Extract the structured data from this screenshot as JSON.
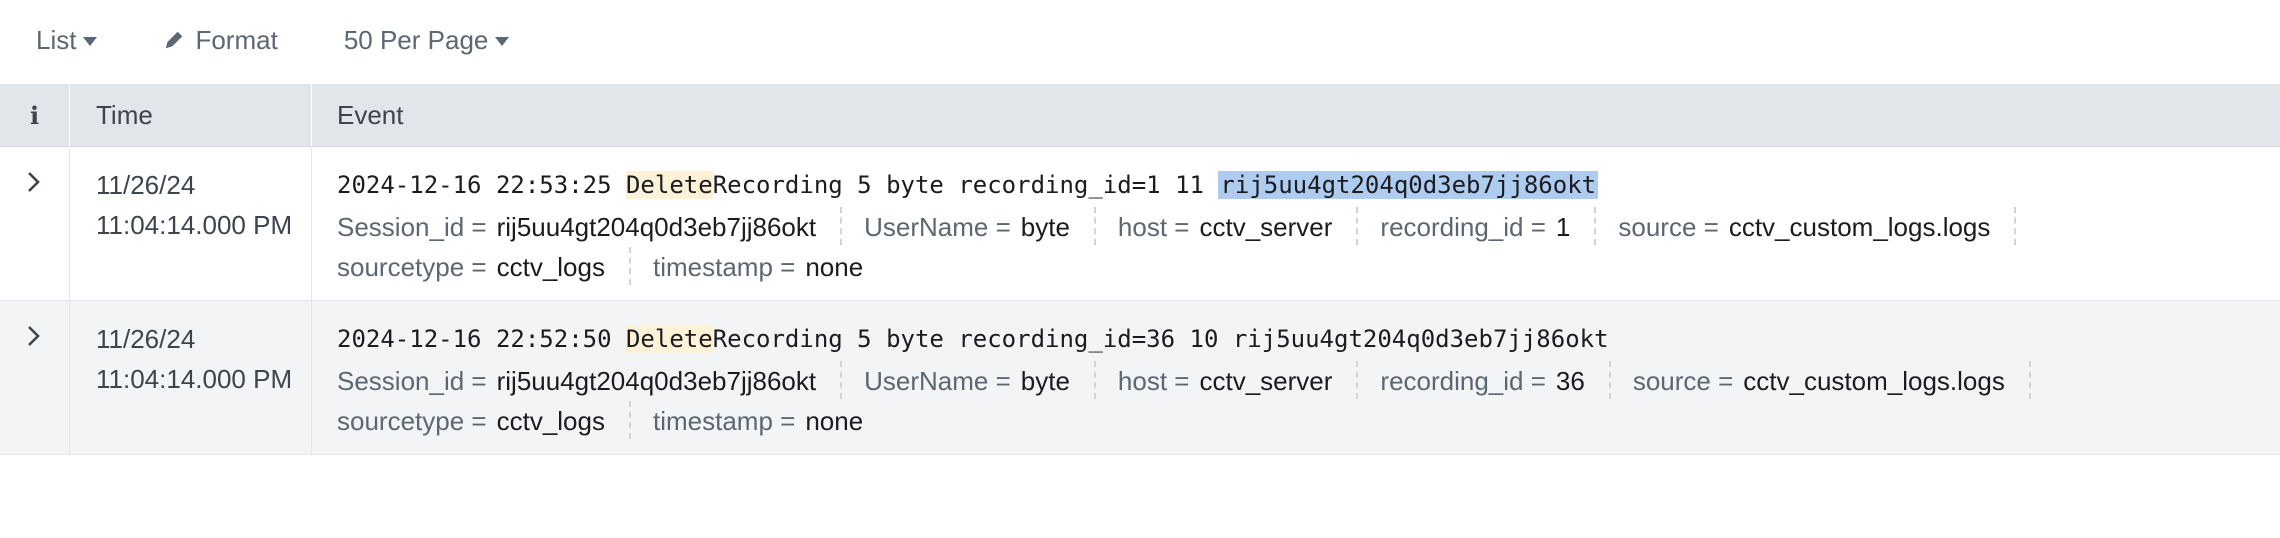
{
  "toolbar": {
    "list_label": "List",
    "format_label": "Format",
    "per_page_label": "50 Per Page"
  },
  "table": {
    "headers": {
      "info": "i",
      "time": "Time",
      "event": "Event"
    },
    "rows": [
      {
        "date": "11/26/24",
        "time": "11:04:14.000 PM",
        "raw_ts": "2024-12-16 22:53:25 ",
        "raw_hl": "Delete",
        "raw_mid": "Recording 5 byte recording_id=1 11 ",
        "raw_sel": "rij5uu4gt204q0d3eb7jj86okt",
        "fields": {
          "session_key": "Session_id =",
          "session_val": "rij5uu4gt204q0d3eb7jj86okt",
          "user_key": "UserName =",
          "user_val": "byte",
          "host_key": "host =",
          "host_val": "cctv_server",
          "rec_key": "recording_id =",
          "rec_val": "1",
          "source_key": "source =",
          "source_val": "cctv_custom_logs.logs",
          "stype_key": "sourcetype =",
          "stype_val": "cctv_logs",
          "ts_key": "timestamp =",
          "ts_val": "none"
        }
      },
      {
        "date": "11/26/24",
        "time": "11:04:14.000 PM",
        "raw_ts": "2024-12-16 22:52:50 ",
        "raw_hl": "Delete",
        "raw_mid": "Recording 5 byte recording_id=36 10 rij5uu4gt204q0d3eb7jj86okt",
        "fields": {
          "session_key": "Session_id =",
          "session_val": "rij5uu4gt204q0d3eb7jj86okt",
          "user_key": "UserName =",
          "user_val": "byte",
          "host_key": "host =",
          "host_val": "cctv_server",
          "rec_key": "recording_id =",
          "rec_val": "36",
          "source_key": "source =",
          "source_val": "cctv_custom_logs.logs",
          "stype_key": "sourcetype =",
          "stype_val": "cctv_logs",
          "ts_key": "timestamp =",
          "ts_val": "none"
        }
      }
    ]
  },
  "colors": {
    "header_bg": "#e1e6eb",
    "alt_row_bg": "#f2f4f5",
    "keyword_highlight": "#fdf1d7",
    "selection_highlight": "#aecbf0"
  },
  "icons": {
    "list_caret": "caret-down-icon",
    "format": "pencil-icon",
    "per_page_caret": "caret-down-icon",
    "info": "info-icon",
    "expand": "chevron-right-icon"
  }
}
